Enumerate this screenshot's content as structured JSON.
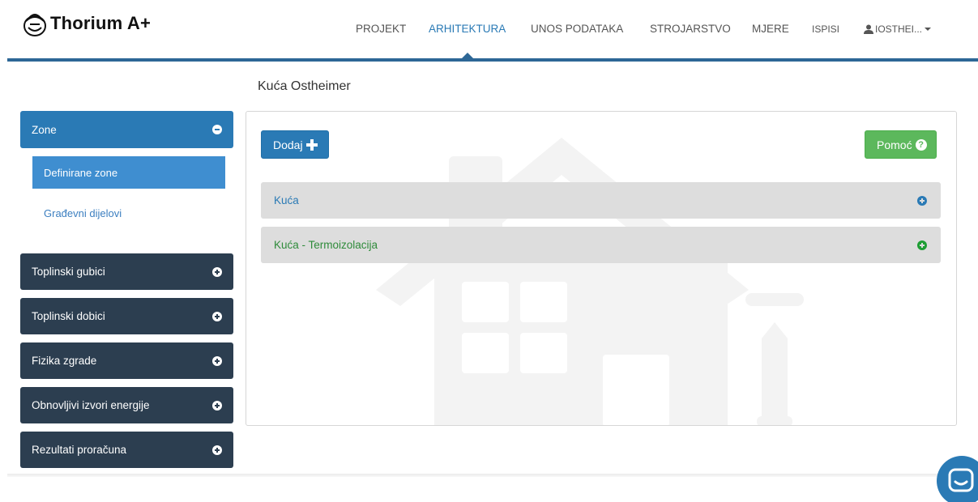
{
  "app": {
    "name": "Thorium A+"
  },
  "nav": {
    "items": [
      {
        "label": "PROJEKT"
      },
      {
        "label": "ARHITEKTURA"
      },
      {
        "label": "UNOS PODATAKA"
      },
      {
        "label": "STROJARSTVO"
      },
      {
        "label": "MJERE"
      },
      {
        "label": "ISPISI"
      }
    ],
    "active": "ARHITEKTURA",
    "user": "IOSTHEI..."
  },
  "page": {
    "title": "Kuća Ostheimer"
  },
  "sidebar": {
    "zone": {
      "label": "Zone",
      "sub_items": [
        {
          "label": "Definirane zone"
        },
        {
          "label": "Građevni dijelovi"
        }
      ]
    },
    "sections": [
      {
        "label": "Toplinski gubici"
      },
      {
        "label": "Toplinski dobici"
      },
      {
        "label": "Fizika zgrade"
      },
      {
        "label": "Obnovljivi izvori energije"
      },
      {
        "label": "Rezultati proračuna"
      }
    ]
  },
  "main": {
    "add_label": "Dodaj",
    "help_label": "Pomoć",
    "zones": [
      {
        "label": "Kuća"
      },
      {
        "label": "Kuća - Termoizolacija"
      }
    ]
  },
  "colors": {
    "primary": "#2a7ab5",
    "sidebar_dark": "#2c3e50",
    "success": "#5cb85c",
    "header_line": "#2d6796"
  }
}
